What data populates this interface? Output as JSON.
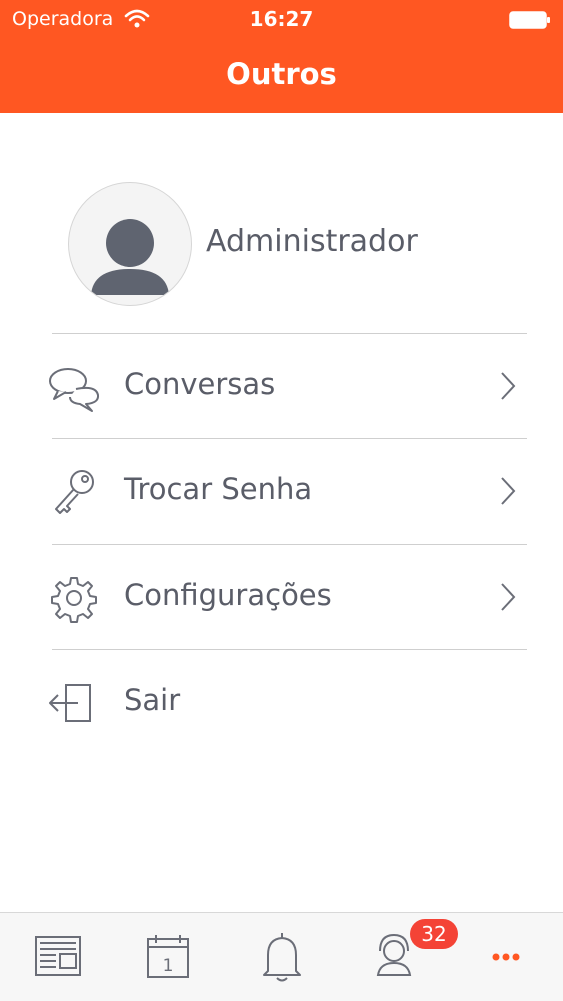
{
  "status_bar": {
    "carrier": "Operadora",
    "time": "16:27"
  },
  "nav": {
    "title": "Outros"
  },
  "profile": {
    "name": "Administrador",
    "avatar_icon": "user-avatar-icon"
  },
  "menu": {
    "items": [
      {
        "label": "Conversas",
        "icon": "chat-bubbles-icon"
      },
      {
        "label": "Trocar Senha",
        "icon": "key-icon"
      },
      {
        "label": "Configurações",
        "icon": "gear-icon"
      },
      {
        "label": "Sair",
        "icon": "logout-icon"
      }
    ]
  },
  "tab_bar": {
    "tabs": [
      {
        "icon": "news-icon"
      },
      {
        "icon": "calendar-icon",
        "day": "1"
      },
      {
        "icon": "bell-icon"
      },
      {
        "icon": "support-agent-icon",
        "badge": "32"
      },
      {
        "icon": "more-icon",
        "active": true
      }
    ]
  },
  "colors": {
    "accent": "#ff5722",
    "text": "#5a5d68",
    "badge": "#f44336",
    "icon": "#6b6e78"
  }
}
